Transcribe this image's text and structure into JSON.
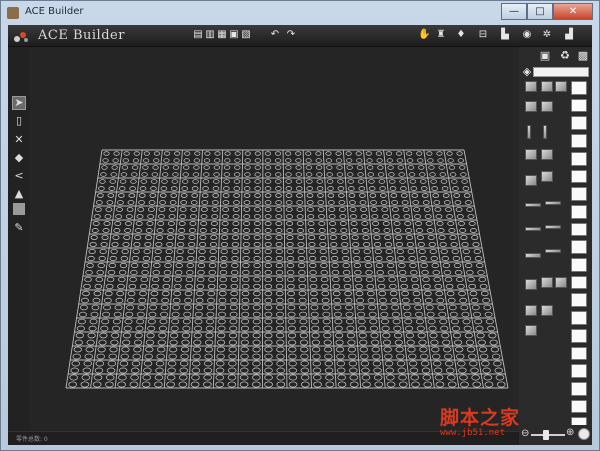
{
  "window": {
    "title": "ACE Builder",
    "buttons": {
      "minimize": "—",
      "maximize": "□",
      "close": "✕"
    }
  },
  "app": {
    "title": "ACE Builder",
    "toolbar_icons": [
      "new-file-icon",
      "open-file-icon",
      "import-icon",
      "save-icon",
      "export-icon",
      "undo-icon",
      "redo-icon",
      "hand-icon",
      "trophy-icon",
      "pin-icon",
      "measure-icon",
      "building-icon",
      "eye-icon",
      "settings-icon",
      "bricks-icon"
    ]
  },
  "left_tools": [
    "select-arrow-icon",
    "page-icon",
    "delete-icon",
    "paint-icon",
    "measure-angle-icon",
    "bucket-icon",
    "color-swatch-icon",
    "eyedropper-icon"
  ],
  "panel": {
    "search_placeholder": "",
    "category_count": 20
  },
  "viewport": {
    "grid": {
      "rows": 17,
      "cols": 18
    },
    "colors": {
      "background": "#252525",
      "line": "#bdbdbd"
    }
  },
  "status": {
    "text": "零件总数: 0"
  },
  "watermark": {
    "site_cn": "脚本之家",
    "url": "www.jb51.net"
  },
  "colors": {
    "accent": "#d83a1f"
  }
}
